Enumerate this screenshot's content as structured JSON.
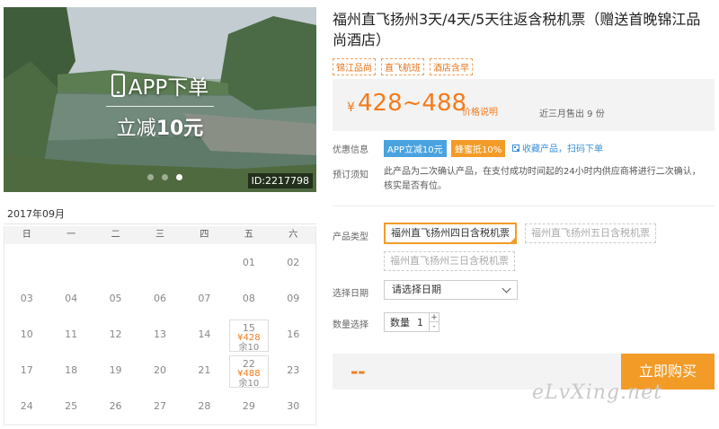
{
  "hero": {
    "promo_line1": "APP下单",
    "promo_line2_prefix": "立减",
    "promo_line2_amount": "10元",
    "photo_id": "ID:2217798",
    "dots": 3,
    "active_dot": 2
  },
  "calendar": {
    "month": "2017年09月",
    "weekdays": [
      "日",
      "一",
      "二",
      "三",
      "四",
      "五",
      "六"
    ],
    "cells": [
      {
        "day": ""
      },
      {
        "day": ""
      },
      {
        "day": ""
      },
      {
        "day": ""
      },
      {
        "day": ""
      },
      {
        "day": "01"
      },
      {
        "day": "02"
      },
      {
        "day": "03"
      },
      {
        "day": "04"
      },
      {
        "day": "05"
      },
      {
        "day": "06"
      },
      {
        "day": "07"
      },
      {
        "day": "08"
      },
      {
        "day": "09"
      },
      {
        "day": "10"
      },
      {
        "day": "11"
      },
      {
        "day": "12"
      },
      {
        "day": "13"
      },
      {
        "day": "14"
      },
      {
        "day": "15",
        "price": "¥428",
        "left": "余10"
      },
      {
        "day": "16"
      },
      {
        "day": "17"
      },
      {
        "day": "18"
      },
      {
        "day": "19"
      },
      {
        "day": "20"
      },
      {
        "day": "21"
      },
      {
        "day": "22",
        "price": "¥488",
        "left": "余10"
      },
      {
        "day": "23"
      },
      {
        "day": "24"
      },
      {
        "day": "25"
      },
      {
        "day": "26"
      },
      {
        "day": "27"
      },
      {
        "day": "28"
      },
      {
        "day": "29"
      },
      {
        "day": "30"
      }
    ]
  },
  "product": {
    "title": "福州直飞扬州3天/4天/5天往返含税机票（赠送首晚锦江品尚酒店）",
    "tags": [
      "锦江品尚",
      "直飞航班",
      "酒店含早"
    ],
    "price_symbol": "¥",
    "price_range": "428~488",
    "price_note": "价格说明",
    "sold": "近三月售出 9 份"
  },
  "offers": {
    "label": "优惠信息",
    "badge_app": "APP立减10元",
    "badge_coupon": "蜂蜜抵10%",
    "fav_scan": "收藏产品，扫码下单"
  },
  "booking_notice": {
    "label": "预订须知",
    "text": "此产品为二次确认产品，在支付成功时间起的24小时内供应商将进行二次确认，核实是否有位。"
  },
  "options": {
    "type_label": "产品类型",
    "types": [
      "福州直飞扬州四日含税机票",
      "福州直飞扬州五日含税机票",
      "福州直飞扬州三日含税机票"
    ],
    "selected_type_index": 0,
    "date_label": "选择日期",
    "date_placeholder": "请选择日期",
    "qty_label": "数量选择",
    "qty_inner_label": "数量",
    "qty_value": "1",
    "qty_plus": "+",
    "qty_minus": "-"
  },
  "purchase": {
    "total": "--",
    "buy_label": "立即购买"
  },
  "watermark": "eLvXing.net",
  "colors": {
    "accent": "#f39b27",
    "price": "#f37b1d",
    "badge_blue": "#4aa3df",
    "link": "#3a8fd6"
  }
}
